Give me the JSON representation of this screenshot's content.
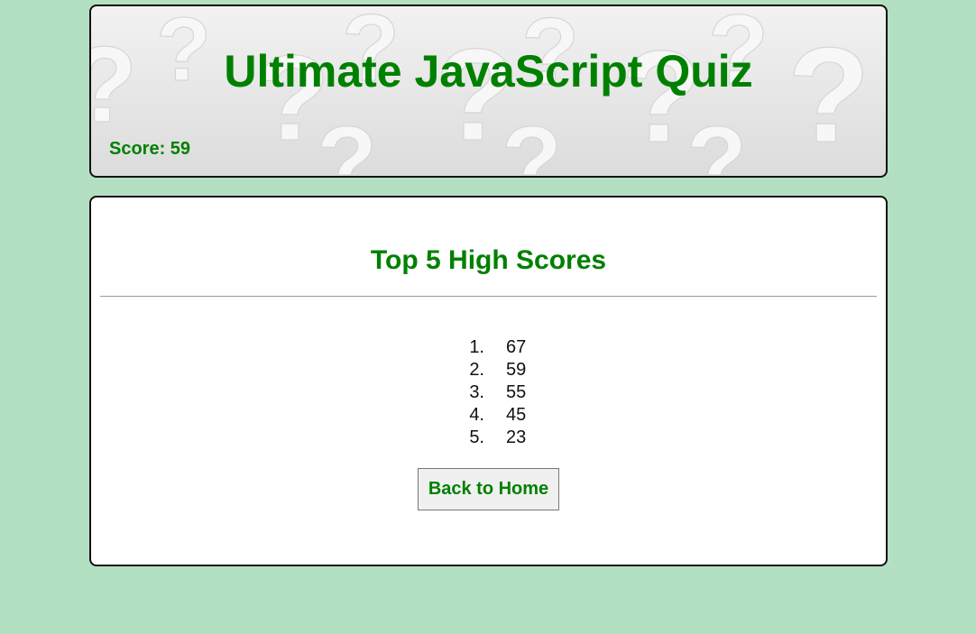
{
  "header": {
    "title": "Ultimate JavaScript Quiz",
    "score_label": "Score: 59"
  },
  "high_scores": {
    "title": "Top 5 High Scores",
    "items": [
      {
        "rank": "1.",
        "score": "67"
      },
      {
        "rank": "2.",
        "score": "59"
      },
      {
        "rank": "3.",
        "score": "55"
      },
      {
        "rank": "4.",
        "score": "45"
      },
      {
        "rank": "5.",
        "score": "23"
      }
    ]
  },
  "actions": {
    "back_label": "Back to Home"
  },
  "colors": {
    "background": "#b3e0c2",
    "accent": "#008000",
    "panel": "#ffffff",
    "border": "#111111"
  }
}
